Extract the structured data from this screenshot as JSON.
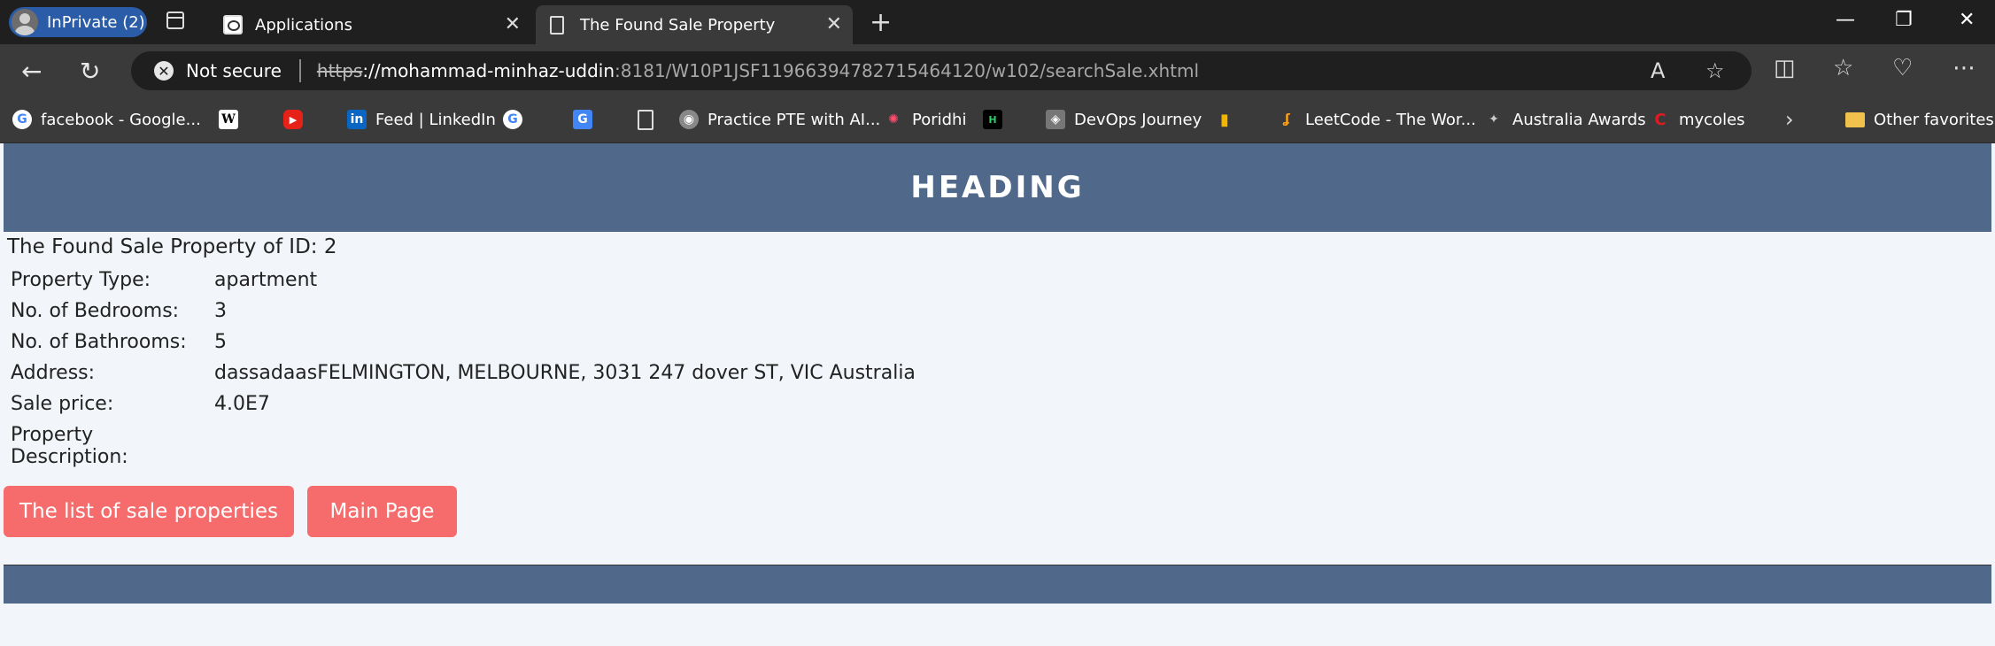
{
  "browser": {
    "inprivate_label": "InPrivate (2)",
    "tabs": [
      {
        "title": "Applications",
        "active": false
      },
      {
        "title": "The Found Sale Property",
        "active": true
      }
    ],
    "url": {
      "security_label": "Not secure",
      "scheme": "https",
      "host": "://mohammad-minhaz-uddin",
      "rest": ":8181/W10P1JSF1196639478271546412‌0/w102/searchSale.xhtml"
    },
    "bookmarks": [
      {
        "label": "facebook - Google...",
        "icon": "google-icon"
      },
      {
        "label": "",
        "icon": "wikipedia-icon"
      },
      {
        "label": "",
        "icon": "youtube-icon"
      },
      {
        "label": "Feed | LinkedIn",
        "icon": "linkedin-icon"
      },
      {
        "label": "",
        "icon": "google-icon"
      },
      {
        "label": "",
        "icon": "google-translate-icon"
      },
      {
        "label": "",
        "icon": "document-icon"
      },
      {
        "label": "Practice PTE with AI...",
        "icon": "pte-icon"
      },
      {
        "label": "Poridhi",
        "icon": "poridhi-icon"
      },
      {
        "label": "",
        "icon": "hackerrank-icon"
      },
      {
        "label": "DevOps Journey",
        "icon": "devops-icon"
      },
      {
        "label": "",
        "icon": "chart-icon"
      },
      {
        "label": "LeetCode - The Wor...",
        "icon": "leetcode-icon"
      },
      {
        "label": "Australia Awards",
        "icon": "australia-awards-icon"
      },
      {
        "label": "mycoles",
        "icon": "coles-icon"
      }
    ],
    "other_favorites": "Other favorites"
  },
  "page": {
    "heading": "HEADING",
    "found_title": "The Found Sale Property of ID: 2",
    "properties": [
      {
        "label": "Property Type:",
        "value": "apartment"
      },
      {
        "label": "No. of Bedrooms:",
        "value": "3"
      },
      {
        "label": "No. of Bathrooms:",
        "value": "5"
      },
      {
        "label": "Address:",
        "value": "dassadaasFELMINGTON, MELBOURNE, 3031 247 dover ST, VIC Australia"
      },
      {
        "label": "Sale price:",
        "value": "4.0E7"
      },
      {
        "label": "Property Description:",
        "value": ""
      }
    ],
    "buttons": {
      "list": "The list of sale properties",
      "main": "Main Page"
    }
  },
  "colors": {
    "header_bg": "#50698a",
    "button_bg": "#f66b6c",
    "page_bg": "#f2f5f9"
  }
}
